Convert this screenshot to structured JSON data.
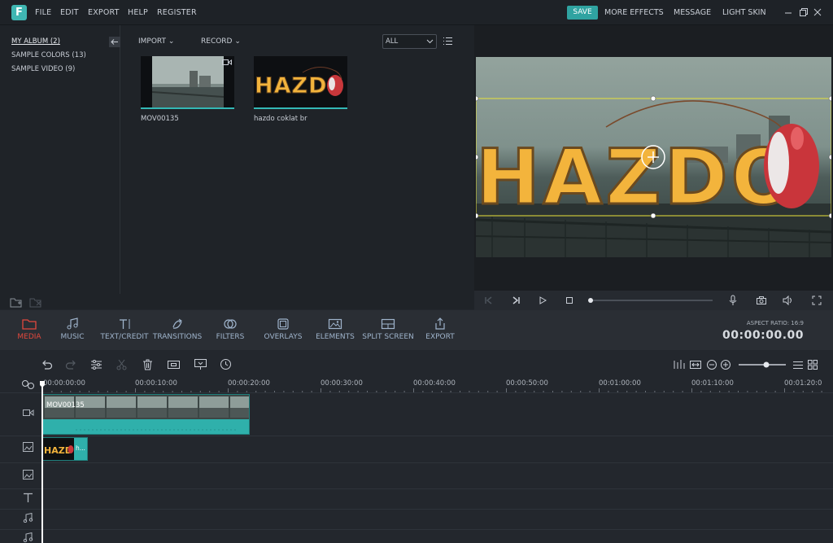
{
  "app": {
    "logo_letter": "F"
  },
  "menu": {
    "file": "FILE",
    "edit": "EDIT",
    "export": "EXPORT",
    "help": "HELP",
    "register": "REGISTER"
  },
  "topright": {
    "save": "SAVE",
    "more_effects": "MORE EFFECTS",
    "message": "MESSAGE",
    "light_skin": "LIGHT SKIN"
  },
  "albums": [
    "MY ALBUM (2)",
    "SAMPLE COLORS (13)",
    "SAMPLE VIDEO (9)"
  ],
  "library_toolbar": {
    "import": "IMPORT",
    "record": "RECORD",
    "filter_value": "ALL"
  },
  "media": [
    {
      "name": "MOV00135"
    },
    {
      "name": "hazdo coklat br"
    }
  ],
  "preview_text": "HAZDO",
  "toolbar": [
    {
      "label": "MEDIA",
      "icon": "folder-icon"
    },
    {
      "label": "MUSIC",
      "icon": "music-icon"
    },
    {
      "label": "TEXT/CREDIT",
      "icon": "text-icon"
    },
    {
      "label": "TRANSITIONS",
      "icon": "transitions-icon"
    },
    {
      "label": "FILTERS",
      "icon": "filters-icon"
    },
    {
      "label": "OVERLAYS",
      "icon": "overlays-icon"
    },
    {
      "label": "ELEMENTS",
      "icon": "elements-icon"
    },
    {
      "label": "SPLIT SCREEN",
      "icon": "split-screen-icon"
    },
    {
      "label": "EXPORT",
      "icon": "export-icon"
    }
  ],
  "aspect_ratio": "ASPECT RATIO: 16:9",
  "timecode": "00:00:00.00",
  "ruler": [
    "00:00:00:00",
    "00:00:10:00",
    "00:00:20:00",
    "00:00:30:00",
    "00:00:40:00",
    "00:00:50:00",
    "00:01:00:00",
    "00:01:10:00",
    "00:01:20:0"
  ],
  "clips": {
    "video": "MOV00135",
    "image": "h..."
  },
  "colors": {
    "accent": "#2fa3a1",
    "active_tool": "#e2483d",
    "clip_teal": "#2fb0ab",
    "selection": "#e8e33a"
  }
}
